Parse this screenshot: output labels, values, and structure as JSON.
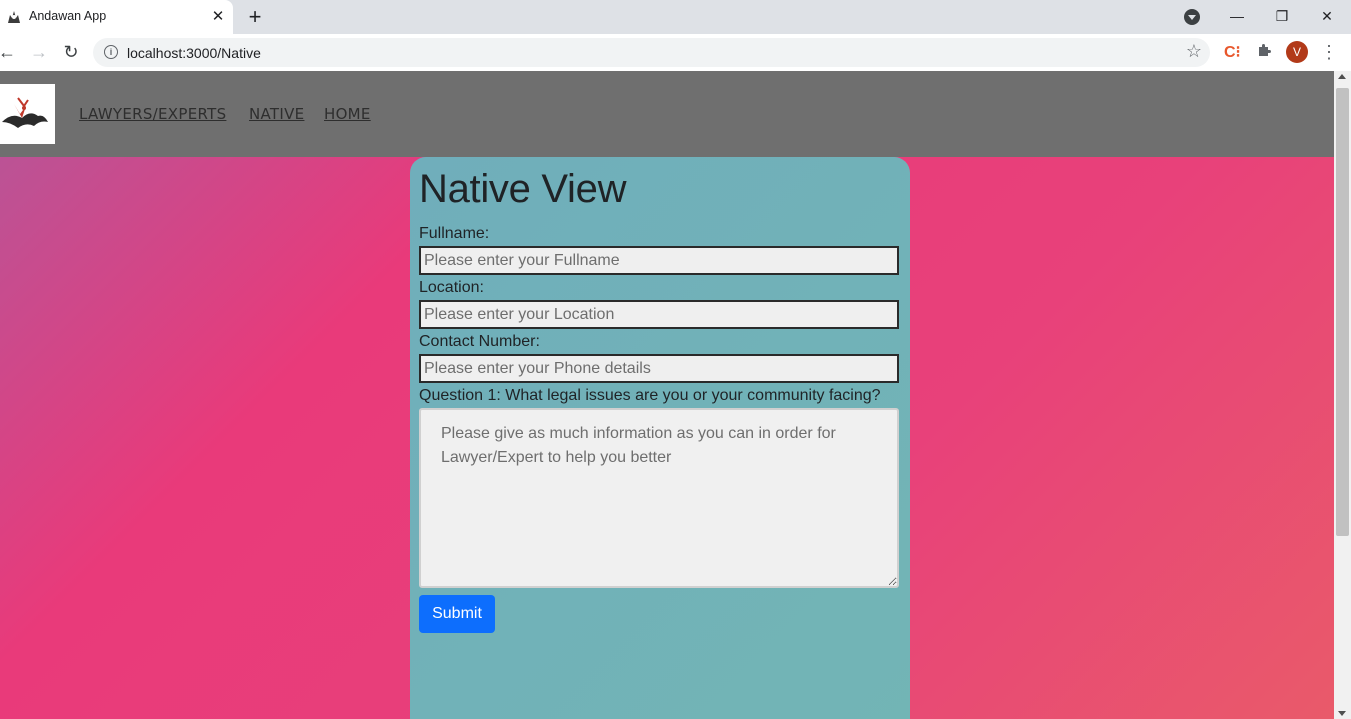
{
  "browser": {
    "tab_title": "Andawan App",
    "tab_close": "✕",
    "new_tab": "+",
    "url": "localhost:3000/Native",
    "profile_initial": "V",
    "extension_label": "C⁝",
    "window_controls": {
      "minimize": "—",
      "restore": "❐",
      "close": "✕"
    },
    "nav": {
      "back": "←",
      "forward": "→",
      "reload": "↻"
    }
  },
  "navbar": {
    "links": [
      {
        "label": "LAWYERS/EXPERTS"
      },
      {
        "label": "NATIVE"
      },
      {
        "label": "HOME"
      }
    ]
  },
  "form": {
    "title": "Native View",
    "fullname": {
      "label": "Fullname:",
      "placeholder": "Please enter your Fullname"
    },
    "location": {
      "label": "Location:",
      "placeholder": "Please enter your Location"
    },
    "contact": {
      "label": "Contact Number:",
      "placeholder": "Please enter your Phone details"
    },
    "question1": {
      "label": "Question 1: What legal issues are you or your community facing?",
      "placeholder": "Please give as much information as you can in order for Lawyer/Expert to help you better"
    },
    "submit_label": "Submit"
  },
  "colors": {
    "navbar_bg": "#6f6f6f",
    "card_bg": "#70aebb",
    "page_gradient": [
      "#b3579a",
      "#e93a7a",
      "#e95a6a"
    ],
    "submit_bg": "#0d6efd",
    "avatar_bg": "#b23a19"
  },
  "icons": {
    "favicon": "wolf-logo-icon",
    "info": "info-icon",
    "bookmark": "star-icon",
    "extensions": "puzzle-icon",
    "menu": "kebab-menu-icon"
  }
}
